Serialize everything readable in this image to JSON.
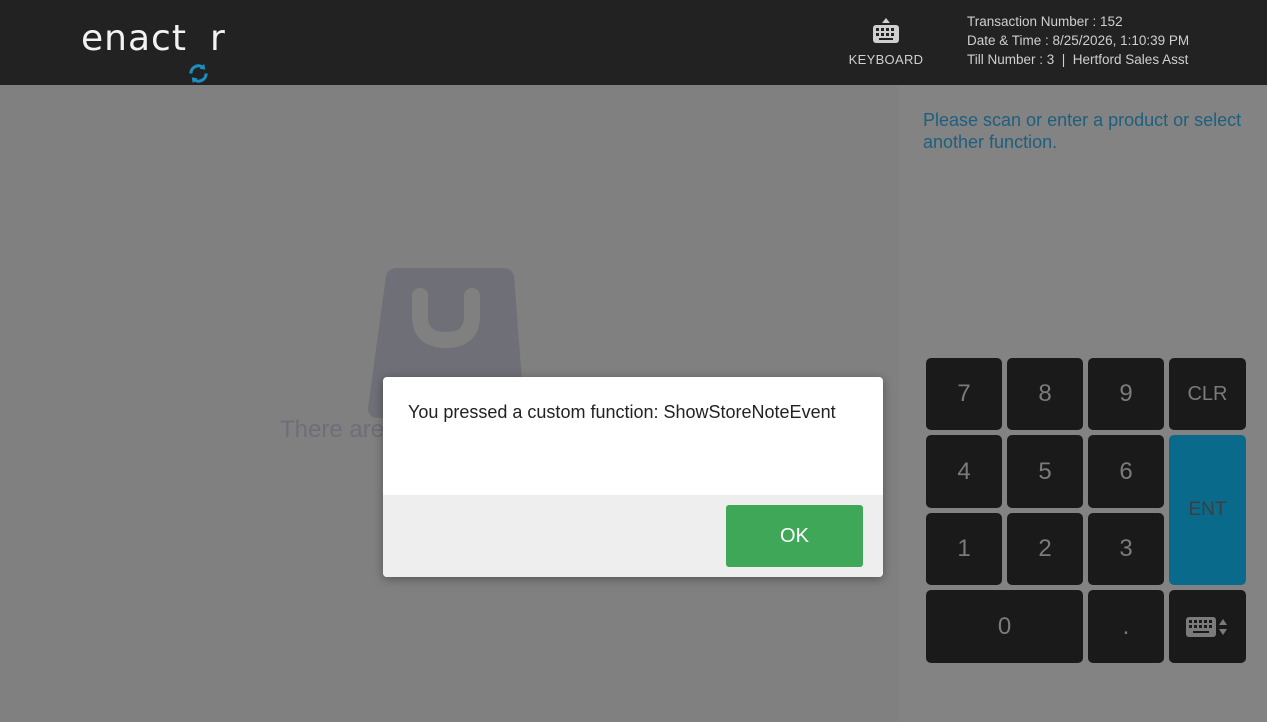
{
  "header": {
    "logo_text_before": "enact",
    "logo_text_after": "r",
    "keyboard_label": "KEYBOARD",
    "transaction_number": "Transaction Number : 152",
    "date_time": "Date & Time : 8/25/2026, 1:10:39 PM",
    "till": "Till Number : 3  |  Hertford Sales Asst"
  },
  "main": {
    "empty_message": "There are"
  },
  "right_panel": {
    "prompt": "Please scan or enter a product or select another function."
  },
  "keypad": {
    "k7": "7",
    "k8": "8",
    "k9": "9",
    "clr": "CLR",
    "k4": "4",
    "k5": "5",
    "k6": "6",
    "ent": "ENT",
    "k1": "1",
    "k2": "2",
    "k3": "3",
    "k0": "0",
    "dot": "."
  },
  "dialog": {
    "message": "You pressed a custom function: ShowStoreNoteEvent",
    "ok_label": "OK"
  },
  "colors": {
    "header_bg": "#222222",
    "brand_accent": "#1a8fc0",
    "ok_green": "#3ea858",
    "ent_blue": "#0a6a8c"
  }
}
